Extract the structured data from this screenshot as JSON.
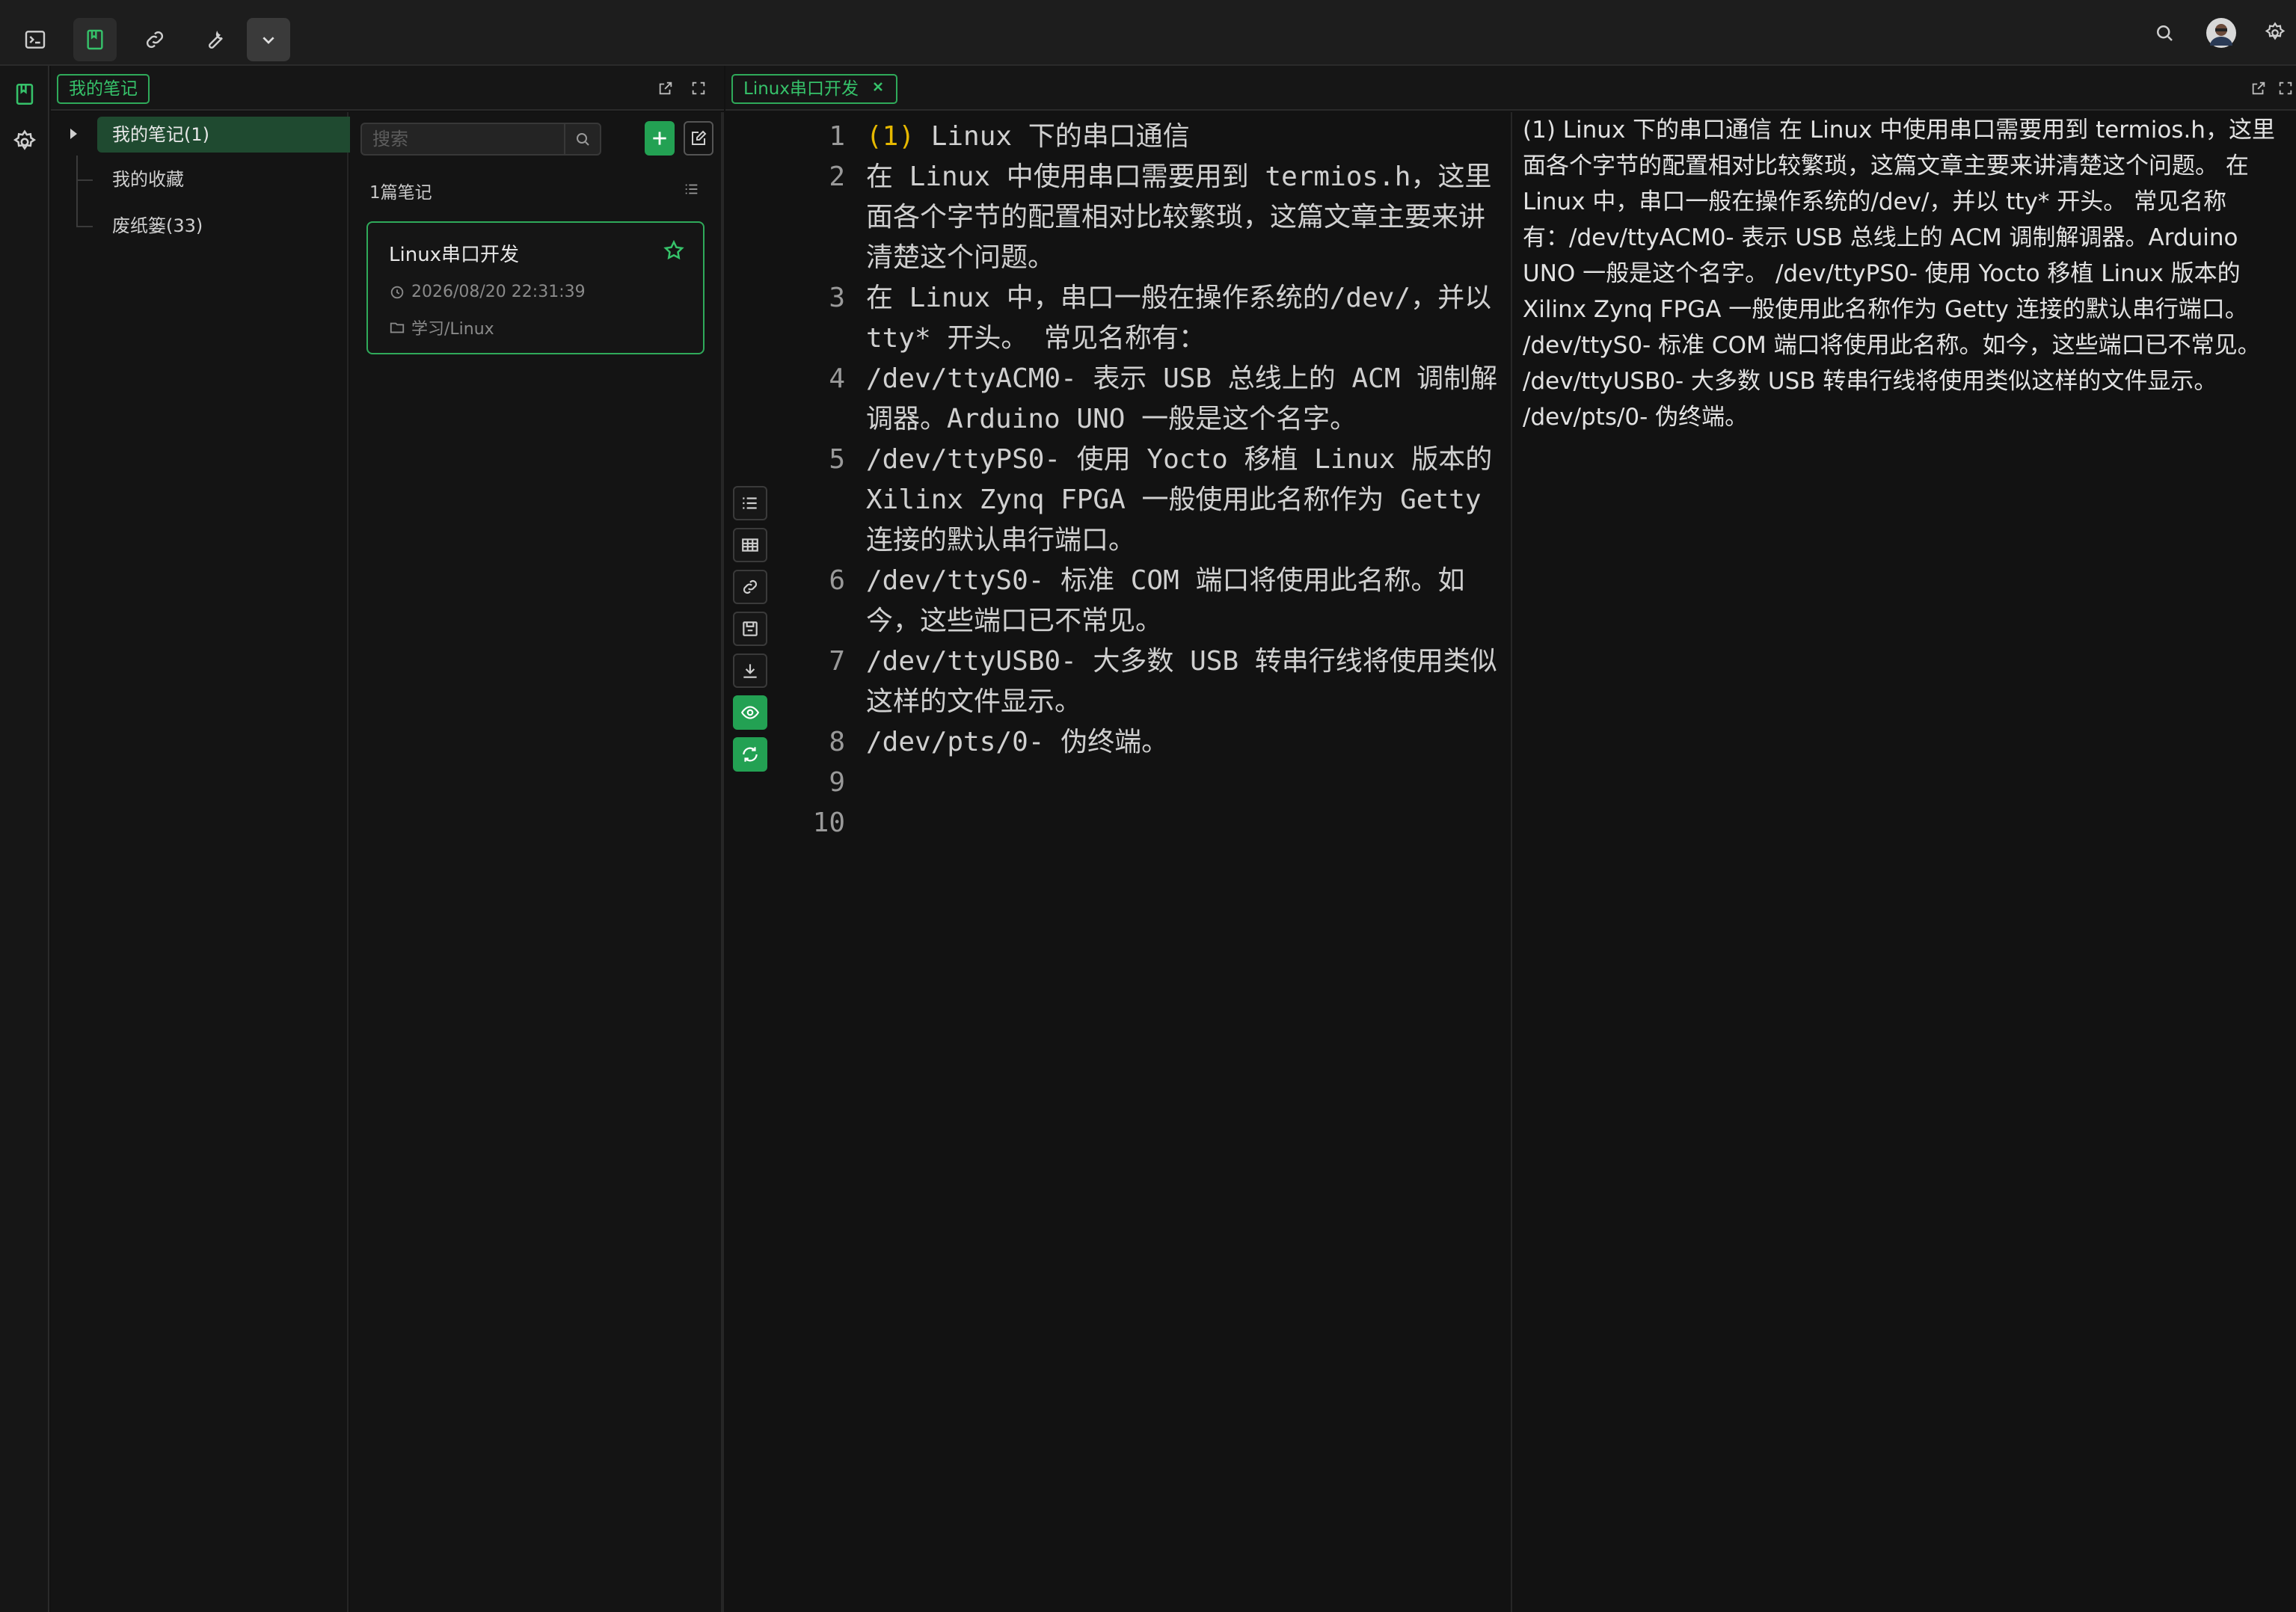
{
  "topbar": {
    "left_icons": [
      "terminal-icon",
      "note-icon",
      "link-icon",
      "wrench-icon",
      "chevron-down-icon"
    ],
    "right_icons": [
      "search-icon",
      "avatar",
      "settings-icon"
    ]
  },
  "left_panel": {
    "tab_label": "我的笔记",
    "tree": [
      {
        "label": "我的笔记(1)",
        "selected": true
      },
      {
        "label": "我的收藏",
        "selected": false
      },
      {
        "label": "废纸篓(33)",
        "selected": false
      }
    ],
    "search_placeholder": "搜索",
    "count_label": "1篇笔记",
    "card": {
      "title": "Linux串口开发",
      "time": "2026/08/20 22:31:39",
      "folder": "学习/Linux"
    }
  },
  "editor": {
    "tab_label": "Linux串口开发",
    "lines": [
      {
        "n": "1",
        "text": "(1) Linux 下的串口通信"
      },
      {
        "n": "2",
        "text": "在 Linux 中使用串口需要用到 termios.h，这里面各个字节的配置相对比较繁琐，这篇文章主要来讲清楚这个问题。"
      },
      {
        "n": "3",
        "text": "在 Linux 中，串口一般在操作系统的/dev/，并以 tty* 开头。 常见名称有："
      },
      {
        "n": "4",
        "text": "/dev/ttyACM0- 表示 USB 总线上的 ACM 调制解调器。Arduino UNO 一般是这个名字。"
      },
      {
        "n": "5",
        "text": "/dev/ttyPS0- 使用 Yocto 移植 Linux 版本的 Xilinx Zynq FPGA 一般使用此名称作为 Getty 连接的默认串行端口。"
      },
      {
        "n": "6",
        "text": "/dev/ttyS0- 标准 COM 端口将使用此名称。如今，这些端口已不常见。"
      },
      {
        "n": "7",
        "text": "/dev/ttyUSB0- 大多数 USB 转串行线将使用类似这样的文件显示。"
      },
      {
        "n": "8",
        "text": "/dev/pts/0- 伪终端。"
      },
      {
        "n": "9",
        "text": ""
      },
      {
        "n": "10",
        "text": ""
      }
    ]
  },
  "preview": {
    "text": "(1) Linux 下的串口通信 在 Linux 中使用串口需要用到 termios.h，这里面各个字节的配置相对比较繁琐，这篇文章主要来讲清楚这个问题。 在 Linux 中，串口一般在操作系统的/dev/，并以 tty* 开头。 常见名称有：/dev/ttyACM0- 表示 USB 总线上的 ACM 调制解调器。Arduino UNO 一般是这个名字。 /dev/ttyPS0- 使用 Yocto 移植 Linux 版本的 Xilinx Zynq FPGA 一般使用此名称作为 Getty 连接的默认串行端口。 /dev/ttyS0- 标准 COM 端口将使用此名称。如今，这些端口已不常见。 /dev/ttyUSB0- 大多数 USB 转串行线将使用类似这样的文件显示。 /dev/pts/0- 伪终端。"
  },
  "colors": {
    "accent": "#2faa5a",
    "accent_fill": "#23a153",
    "highlight": "#e6b800"
  }
}
